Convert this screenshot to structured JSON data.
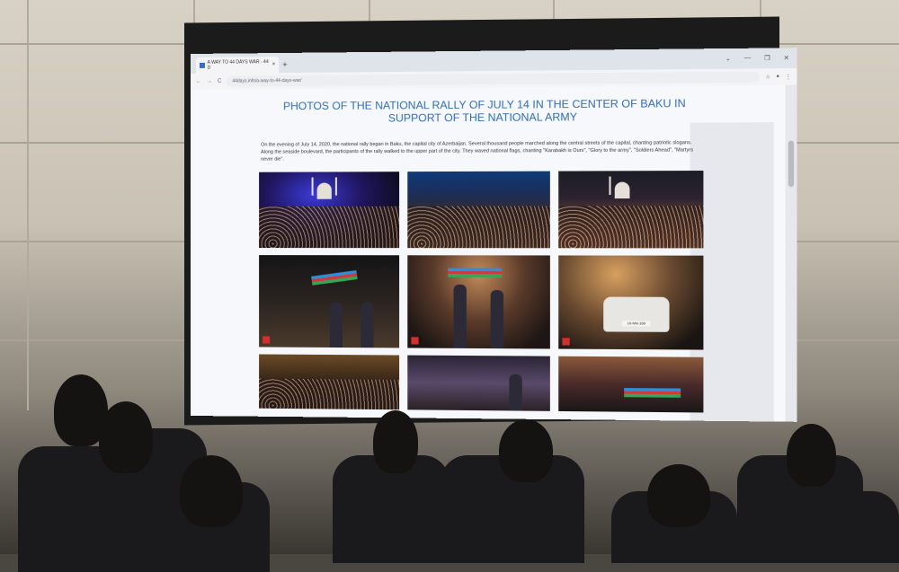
{
  "browser": {
    "tab_title": "A WAY TO 44 DAYS WAR - 44 D",
    "new_tab_label": "+",
    "window_controls": [
      "⌄",
      "—",
      "❐",
      "✕"
    ],
    "nav": [
      "←",
      "→",
      "C"
    ],
    "url": "44days.info/a-way-to-44-days-war/",
    "toolbar_icons": [
      "☆",
      "●",
      "⋮"
    ]
  },
  "page": {
    "title": "PHOTOS OF THE NATIONAL RALLY OF JULY 14 IN THE CENTER OF BAKU IN SUPPORT OF THE NATIONAL ARMY",
    "paragraph": "On the evening of July 14, 2020, the national rally began in Baku, the capital city of Azerbaijan. Several thousand people marched along the central streets of the capital, chanting patriotic slogans. Along the seaside boulevard, the participants of the rally walked to the upper part of the city. They waved national flags, chanting \"Karabakh is Ours\", \"Glory to the army\", \"Soldiers Ahead\", \"Martyrs never die\".",
    "car_plate": "10-NN-169"
  },
  "colors": {
    "title": "#2e6db7",
    "tab_bar": "#dfe3ea",
    "page_bg": "#f7f8fb"
  }
}
